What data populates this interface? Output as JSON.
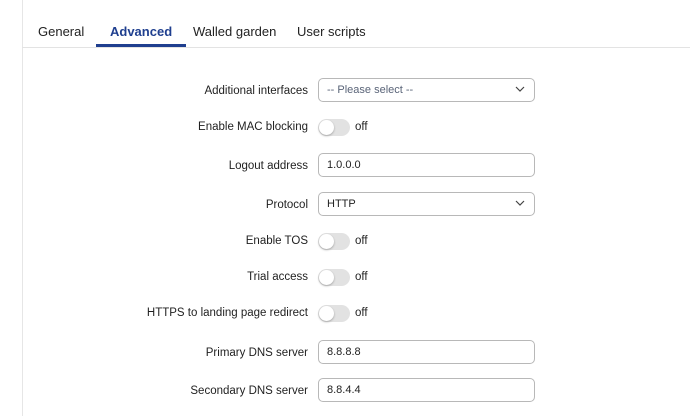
{
  "tabs": [
    {
      "label": "General",
      "active": false
    },
    {
      "label": "Advanced",
      "active": true
    },
    {
      "label": "Walled garden",
      "active": false
    },
    {
      "label": "User scripts",
      "active": false
    }
  ],
  "form": {
    "additional_interfaces": {
      "label": "Additional interfaces",
      "placeholder": "-- Please select --"
    },
    "enable_mac_blocking": {
      "label": "Enable MAC blocking",
      "state": "off"
    },
    "logout_address": {
      "label": "Logout address",
      "value": "1.0.0.0"
    },
    "protocol": {
      "label": "Protocol",
      "value": "HTTP"
    },
    "enable_tos": {
      "label": "Enable TOS",
      "state": "off"
    },
    "trial_access": {
      "label": "Trial access",
      "state": "off"
    },
    "https_redirect": {
      "label": "HTTPS to landing page redirect",
      "state": "off"
    },
    "primary_dns": {
      "label": "Primary DNS server",
      "value": "8.8.8.8"
    },
    "secondary_dns": {
      "label": "Secondary DNS server",
      "value": "8.8.4.4"
    }
  },
  "colors": {
    "accent": "#1f3f8f",
    "toggle_off": "#e2e2e2",
    "border": "#b8b8b8"
  },
  "icons": {
    "select_arrow": "chevron-down-icon"
  }
}
